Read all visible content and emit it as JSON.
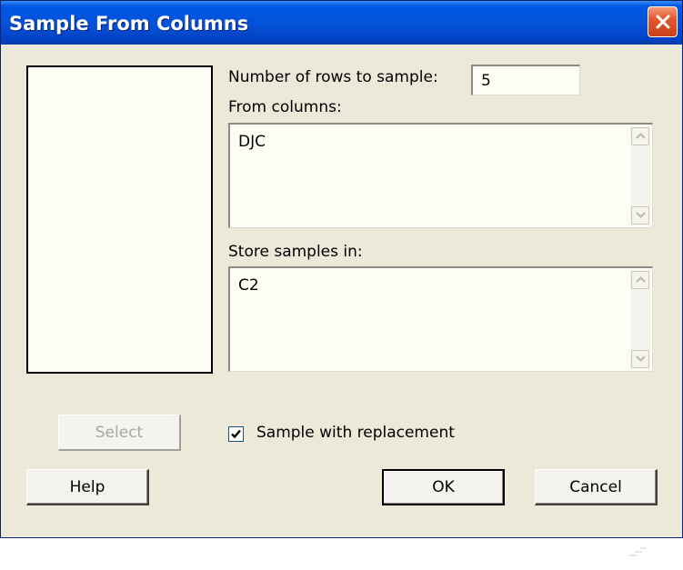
{
  "dialog": {
    "title": "Sample From Columns",
    "icons": {
      "close": "close-icon"
    },
    "colors": {
      "titlebar": "#0451d6",
      "close_button": "#e2592e",
      "dialog_bg": "#ece9d8",
      "field_bg": "#fffef5"
    }
  },
  "form": {
    "rows_label": "Number of rows to sample:",
    "rows_value": "5",
    "from_label": "From columns:",
    "from_value": "DJC",
    "store_label": "Store samples in:",
    "store_value": "C2",
    "replacement_label": "Sample with replacement",
    "replacement_checked": true
  },
  "buttons": {
    "select": "Select",
    "help": "Help",
    "ok": "OK",
    "cancel": "Cancel"
  }
}
